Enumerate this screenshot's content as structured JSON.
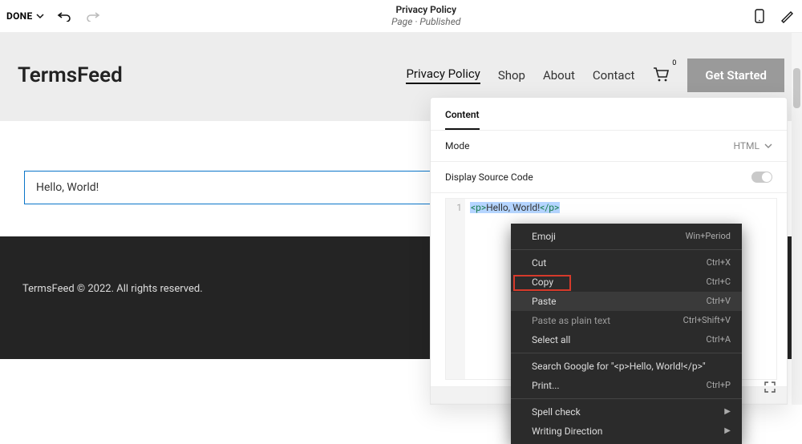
{
  "editor": {
    "done": "DONE",
    "page_title": "Privacy Policy",
    "page_status": "Page · Published"
  },
  "site": {
    "brand": "TermsFeed",
    "nav": {
      "privacy": "Privacy Policy",
      "shop": "Shop",
      "about": "About",
      "contact": "Contact"
    },
    "cart_count": "0",
    "cta": "Get Started",
    "hello_text": "Hello, World!",
    "footer": "TermsFeed © 2022. All rights reserved."
  },
  "panel": {
    "tab": "Content",
    "mode_label": "Mode",
    "mode_value": "HTML",
    "source_label": "Display Source Code",
    "code_line_no": "1",
    "code_open": "<p>",
    "code_text": "Hello, World!",
    "code_close": "</p>"
  },
  "ctx": {
    "emoji": "Emoji",
    "emoji_sc": "Win+Period",
    "cut": "Cut",
    "cut_sc": "Ctrl+X",
    "copy": "Copy",
    "copy_sc": "Ctrl+C",
    "paste": "Paste",
    "paste_sc": "Ctrl+V",
    "paste_plain": "Paste as plain text",
    "paste_plain_sc": "Ctrl+Shift+V",
    "select_all": "Select all",
    "select_all_sc": "Ctrl+A",
    "search": "Search Google for \"<p>Hello, World!</p>\"",
    "print": "Print...",
    "print_sc": "Ctrl+P",
    "spell": "Spell check",
    "writing": "Writing Direction"
  }
}
